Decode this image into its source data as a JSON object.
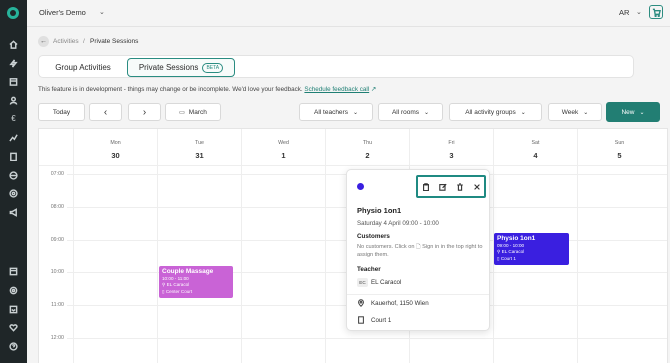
{
  "header": {
    "org_name": "Oliver's Demo",
    "avatar_initials": "AR"
  },
  "breadcrumb": {
    "parent": "Activities",
    "separator": "/",
    "current": "Private Sessions"
  },
  "tabs": [
    {
      "label": "Group Activities"
    },
    {
      "label": "Private Sessions",
      "badge": "BETA"
    }
  ],
  "notice": {
    "text": "This feature is in development - things may change or be incomplete. We'd love your feedback.",
    "link": "Schedule feedback call"
  },
  "toolbar": {
    "today": "Today",
    "prev_icon": "‹",
    "next_icon": "›",
    "month": "March",
    "teachers": "All teachers",
    "rooms": "All rooms",
    "groups": "All activity groups",
    "view": "Week",
    "new": "New"
  },
  "calendar": {
    "days": [
      {
        "name": "Mon",
        "date": "30"
      },
      {
        "name": "Tue",
        "date": "31"
      },
      {
        "name": "Wed",
        "date": "1"
      },
      {
        "name": "Thu",
        "date": "2"
      },
      {
        "name": "Fri",
        "date": "3"
      },
      {
        "name": "Sat",
        "date": "4"
      },
      {
        "name": "Sun",
        "date": "5"
      }
    ],
    "times": [
      "07:00",
      "08:00",
      "09:00",
      "10:00",
      "11:00",
      "12:00"
    ],
    "events": [
      {
        "title": "Couple Massage",
        "time": "10:00 - 11:00",
        "teacher": "EL Caracol",
        "room": "Center Court",
        "color": "#c963d6"
      },
      {
        "title": "Physio 1on1",
        "time": "09:00 - 10:00",
        "teacher": "EL Caracol",
        "room": "Court 1",
        "color": "#3a1fe0"
      }
    ]
  },
  "popup": {
    "title": "Physio 1on1",
    "datetime": "Saturday 4 April  09:00 - 10:00",
    "customers_heading": "Customers",
    "customers_text": "No customers. Click on 🗋 Sign in in the top right to assign them.",
    "teacher_heading": "Teacher",
    "teacher_initials": "EC",
    "teacher_name": "EL Caracol",
    "address": "Kauerhof, 1150 Wien",
    "room": "Court 1",
    "accent": "#3a1fe0"
  },
  "colors": {
    "brand": "#227e73",
    "sidebar": "#1f2628"
  }
}
